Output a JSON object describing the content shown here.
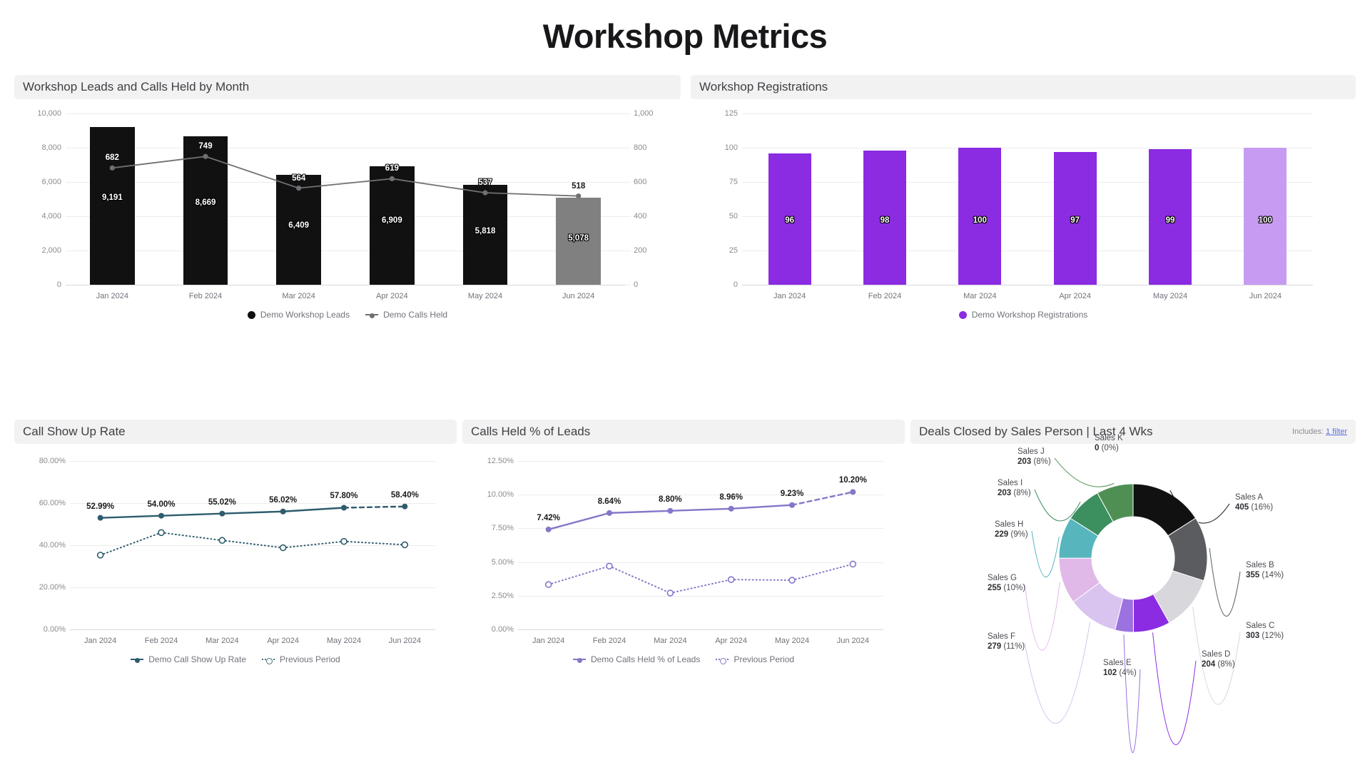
{
  "header": {
    "title": "Workshop Metrics"
  },
  "panels": {
    "leads_calls": {
      "title": "Workshop Leads and Calls Held by Month"
    },
    "registrations": {
      "title": "Workshop Registrations"
    },
    "show_up": {
      "title": "Call Show Up Rate"
    },
    "calls_pct": {
      "title": "Calls Held % of Leads"
    },
    "deals": {
      "title": "Deals Closed by Sales Person | Last 4 Wks",
      "filter_prefix": "Includes:",
      "filter_link": "1 filter"
    }
  },
  "colors": {
    "bar_black": "#111111",
    "bar_gray": "#808080",
    "line_gray": "#6f7074",
    "purple": "#8b2be2",
    "purple_light": "#c79bf2",
    "teal": "#2e5c6e",
    "soft_purple": "#8377c9"
  },
  "chart_data": [
    {
      "type": "bar",
      "id": "leads_calls",
      "title": "Workshop Leads and Calls Held by Month",
      "categories": [
        "Jan 2024",
        "Feb 2024",
        "Mar 2024",
        "Apr 2024",
        "May 2024",
        "Jun 2024"
      ],
      "series": [
        {
          "name": "Demo Workshop Leads",
          "type": "bar",
          "axis": "left",
          "values": [
            9191,
            8669,
            6409,
            6909,
            5818,
            5078
          ],
          "labels": [
            "9,191",
            "8,669",
            "6,409",
            "6,909",
            "5,818",
            "5,078"
          ],
          "partial_last": true
        },
        {
          "name": "Demo Calls Held",
          "type": "line",
          "axis": "right",
          "values": [
            682,
            749,
            564,
            619,
            537,
            518
          ],
          "labels": [
            "682",
            "749",
            "564",
            "619",
            "537",
            "518"
          ],
          "partial_last": true
        }
      ],
      "ylabel": "",
      "xlabel": "",
      "yticks_left": [
        "0",
        "2,000",
        "4,000",
        "6,000",
        "8,000",
        "10,000"
      ],
      "ylim_left": [
        0,
        10000
      ],
      "yticks_right": [
        "0",
        "200",
        "400",
        "600",
        "800",
        "1,000"
      ],
      "ylim_right": [
        0,
        1000
      ],
      "grid": true,
      "legend_position": "bottom"
    },
    {
      "type": "bar",
      "id": "registrations",
      "title": "Workshop Registrations",
      "categories": [
        "Jan 2024",
        "Feb 2024",
        "Mar 2024",
        "Apr 2024",
        "May 2024",
        "Jun 2024"
      ],
      "series": [
        {
          "name": "Demo Workshop Registrations",
          "values": [
            96,
            98,
            100,
            97,
            99,
            100
          ],
          "labels": [
            "96",
            "98",
            "100",
            "97",
            "99",
            "100"
          ],
          "partial_last": true
        }
      ],
      "yticks": [
        "0",
        "25",
        "50",
        "75",
        "100",
        "125"
      ],
      "ylim": [
        0,
        125
      ],
      "grid": true,
      "legend_position": "bottom"
    },
    {
      "type": "line",
      "id": "show_up",
      "title": "Call Show Up Rate",
      "categories": [
        "Jan 2024",
        "Feb 2024",
        "Mar 2024",
        "Apr 2024",
        "May 2024",
        "Jun 2024"
      ],
      "series": [
        {
          "name": "Demo Call Show Up Rate",
          "style": "solid",
          "values": [
            52.99,
            54.0,
            55.02,
            56.02,
            57.8,
            58.4
          ],
          "labels": [
            "52.99%",
            "54.00%",
            "55.02%",
            "56.02%",
            "57.80%",
            "58.40%"
          ],
          "partial_last": true
        },
        {
          "name": "Previous Period",
          "style": "dotted",
          "values": [
            35.3,
            46.0,
            42.3,
            38.8,
            41.8,
            40.2
          ],
          "labels": [],
          "partial_last": false
        }
      ],
      "yticks": [
        "0.00%",
        "20.00%",
        "40.00%",
        "60.00%",
        "80.00%"
      ],
      "ylim": [
        0,
        80
      ],
      "grid": true,
      "legend_position": "bottom"
    },
    {
      "type": "line",
      "id": "calls_pct",
      "title": "Calls Held % of Leads",
      "categories": [
        "Jan 2024",
        "Feb 2024",
        "Mar 2024",
        "Apr 2024",
        "May 2024",
        "Jun 2024"
      ],
      "series": [
        {
          "name": "Demo Calls Held % of Leads",
          "style": "solid",
          "values": [
            7.42,
            8.64,
            8.8,
            8.96,
            9.23,
            10.2
          ],
          "labels": [
            "7.42%",
            "8.64%",
            "8.80%",
            "8.96%",
            "9.23%",
            "10.20%"
          ],
          "partial_last": true
        },
        {
          "name": "Previous Period",
          "style": "dotted",
          "values": [
            3.33,
            4.7,
            2.7,
            3.7,
            3.65,
            4.85
          ],
          "labels": [],
          "partial_last": false
        }
      ],
      "yticks": [
        "0.00%",
        "2.50%",
        "5.00%",
        "7.50%",
        "10.00%",
        "12.50%"
      ],
      "ylim": [
        0,
        12.5
      ],
      "grid": true,
      "legend_position": "bottom"
    },
    {
      "type": "pie",
      "id": "deals",
      "title": "Deals Closed by Sales Person | Last 4 Wks",
      "donut": true,
      "slices": [
        {
          "name": "Sales A",
          "value": 405,
          "pct": "16%",
          "label_value": "405",
          "color": "#111111"
        },
        {
          "name": "Sales B",
          "value": 355,
          "pct": "14%",
          "label_value": "355",
          "color": "#5b5c60"
        },
        {
          "name": "Sales C",
          "value": 303,
          "pct": "12%",
          "label_value": "303",
          "color": "#d8d8dc"
        },
        {
          "name": "Sales D",
          "value": 204,
          "pct": "8%",
          "label_value": "204",
          "color": "#8b2be2"
        },
        {
          "name": "Sales E",
          "value": 102,
          "pct": "4%",
          "label_value": "102",
          "color": "#9b72e0"
        },
        {
          "name": "Sales F",
          "value": 279,
          "pct": "11%",
          "label_value": "279",
          "color": "#d9c3ef"
        },
        {
          "name": "Sales G",
          "value": 255,
          "pct": "10%",
          "label_value": "255",
          "color": "#e0b9e8"
        },
        {
          "name": "Sales H",
          "value": 229,
          "pct": "9%",
          "label_value": "229",
          "color": "#56b5bd"
        },
        {
          "name": "Sales I",
          "value": 203,
          "pct": "8%",
          "label_value": "203",
          "color": "#3c8f5e"
        },
        {
          "name": "Sales J",
          "value": 203,
          "pct": "8%",
          "label_value": "203",
          "color": "#4f8f54"
        },
        {
          "name": "Sales K",
          "value": 0,
          "pct": "0%",
          "label_value": "0",
          "color": "#c4dbb1"
        }
      ]
    }
  ]
}
